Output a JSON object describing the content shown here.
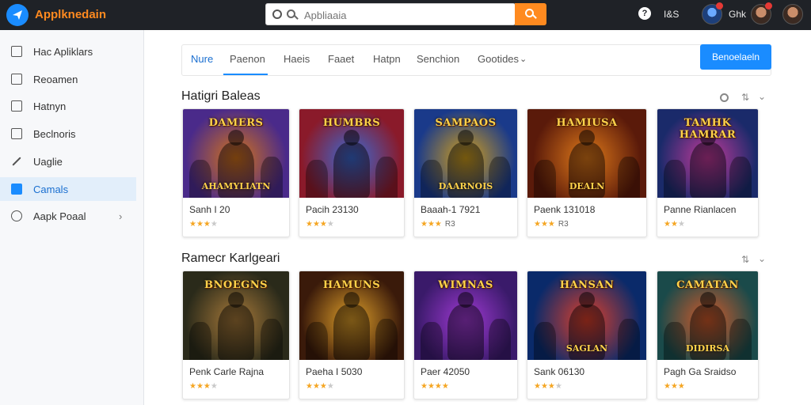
{
  "header": {
    "app_name": "Applknedain",
    "search_placeholder": "Apbliaaia",
    "help_icon": "question-icon",
    "text1": "I&S",
    "text2": "Ghk"
  },
  "sidebar": {
    "items": [
      {
        "label": "Hac Apliklars",
        "icon": "square-icon"
      },
      {
        "label": "Reoamen",
        "icon": "edit-icon"
      },
      {
        "label": "Hatnyn",
        "icon": "square-icon"
      },
      {
        "label": "Beclnoris",
        "icon": "card-icon"
      },
      {
        "label": "Uaglie",
        "icon": "pen-icon"
      },
      {
        "label": "Camals",
        "icon": "tag-icon"
      },
      {
        "label": "Aapk Poaal",
        "icon": "circle-icon"
      }
    ]
  },
  "tabs": [
    {
      "label": "Nure"
    },
    {
      "label": "Paenon"
    },
    {
      "label": "Haeis"
    },
    {
      "label": "Faaet"
    },
    {
      "label": "Hatpn"
    },
    {
      "label": "Senchion"
    },
    {
      "label": "Gootides"
    }
  ],
  "tab_button": "Benoelaeln",
  "section1": {
    "title": "Hatigri Baleas",
    "cards": [
      {
        "banner": "DAMERS",
        "banner2": "AHAMYLIATN",
        "title": "Sanh I 20",
        "stars": 3.5,
        "rating_text": "",
        "bg1": "#4a2a8a",
        "bg2": "#d4731a"
      },
      {
        "banner": "HUMBRS",
        "banner2": "",
        "title": "Pacih 23130",
        "stars": 3.5,
        "rating_text": "",
        "bg1": "#8a1a2a",
        "bg2": "#3a6ad4"
      },
      {
        "banner": "SAMPAOS",
        "banner2": "DAARNOIS",
        "title": "Baaah-1 7921",
        "stars": 3,
        "rating_text": "R3",
        "bg1": "#1a3a8a",
        "bg2": "#d4a01a"
      },
      {
        "banner": "HAMIUSA",
        "banner2": "DEALN",
        "title": "Paenk 131018",
        "stars": 3,
        "rating_text": "R3",
        "bg1": "#5a1a0a",
        "bg2": "#e07a1a"
      },
      {
        "banner": "TAMHK HAMRAR",
        "banner2": "",
        "title": "Panne Rianlacen",
        "stars": 2.5,
        "rating_text": "",
        "bg1": "#1a2a6a",
        "bg2": "#c43a9a"
      }
    ]
  },
  "section2": {
    "title": "Ramecr Karlgeari",
    "cards": [
      {
        "banner": "BNOEGNS",
        "banner2": "",
        "title": "Penk Carle Rajna",
        "stars": 3.5,
        "rating_text": "",
        "bg1": "#2a2a1a",
        "bg2": "#a87a3a"
      },
      {
        "banner": "HAMUNS",
        "banner2": "",
        "title": "Paeha I 5030",
        "stars": 3.5,
        "rating_text": "",
        "bg1": "#3a1a0a",
        "bg2": "#e0a02a"
      },
      {
        "banner": "WIMNAS",
        "banner2": "",
        "title": "Paer 42050",
        "stars": 4,
        "rating_text": "",
        "bg1": "#3a1a6a",
        "bg2": "#a03ad4"
      },
      {
        "banner": "HANSAN",
        "banner2": "SAGLAN",
        "title": "Sank 06130",
        "stars": 3.5,
        "rating_text": "",
        "bg1": "#0a2a6a",
        "bg2": "#e0402a"
      },
      {
        "banner": "CAMATAN",
        "banner2": "DIDIRSA",
        "title": "Pagh Ga Sraidso",
        "stars": 3,
        "rating_text": "",
        "bg1": "#1a4a4a",
        "bg2": "#d45a2a"
      }
    ]
  },
  "colors": {
    "accent": "#1a8cff",
    "orange": "#ff8a1f",
    "topbar": "#1f2227"
  }
}
